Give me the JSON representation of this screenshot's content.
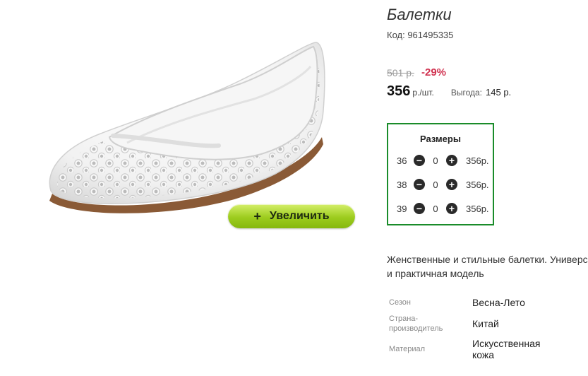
{
  "product": {
    "title": "Балетки",
    "code": "Код: 961495335",
    "zoom_label": "Увеличить",
    "zoom_plus": "+",
    "description_line1": "Женственные и стильные балетки. Универс",
    "description_line2": "и практичная модель"
  },
  "pricing": {
    "old_price": "501 р.",
    "discount": "-29%",
    "price": "356",
    "unit": "р./шт.",
    "saving_label": "Выгода:",
    "saving_value": "145 р."
  },
  "sizes": {
    "title": "Размеры",
    "minus_icon": "−",
    "plus_icon": "+",
    "rows": [
      {
        "size": "36",
        "qty": "0",
        "price": "356р."
      },
      {
        "size": "38",
        "qty": "0",
        "price": "356р."
      },
      {
        "size": "39",
        "qty": "0",
        "price": "356р."
      }
    ]
  },
  "properties": [
    {
      "label": "Сезон",
      "value": "Весна-Лето"
    },
    {
      "label": "Страна-производитель",
      "value": "Китай"
    },
    {
      "label": "Материал",
      "value": "Искусственная кожа"
    }
  ],
  "colors": {
    "sizes_border": "#1a8c2a",
    "discount": "#d0314f",
    "zoom_button": "#9ccc1e"
  }
}
